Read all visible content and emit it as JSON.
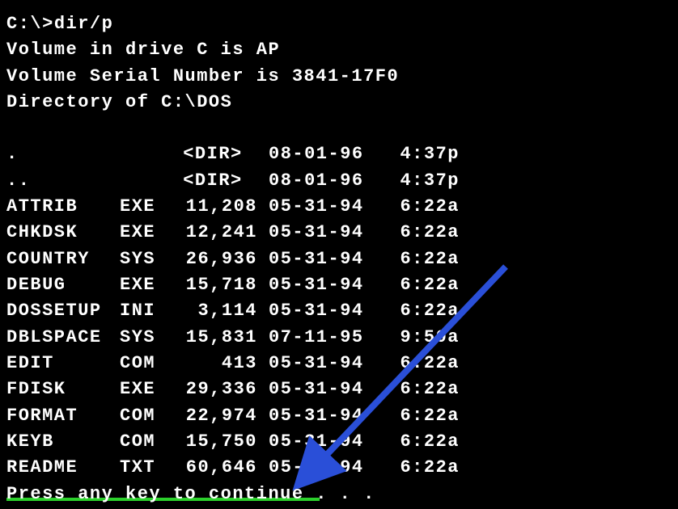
{
  "command": {
    "prompt": "C:\\>",
    "text": "dir/p"
  },
  "header": {
    "volume_line": " Volume in drive C is AP",
    "serial_line": " Volume Serial Number is 3841-17F0",
    "directory_line": " Directory of C:\\DOS"
  },
  "entries": [
    {
      "name": ".",
      "ext": "",
      "size": "",
      "dir": true,
      "date": "08-01-96",
      "time": "4:37p"
    },
    {
      "name": "..",
      "ext": "",
      "size": "",
      "dir": true,
      "date": "08-01-96",
      "time": "4:37p"
    },
    {
      "name": "ATTRIB",
      "ext": "EXE",
      "size": "11,208",
      "dir": false,
      "date": "05-31-94",
      "time": "6:22a"
    },
    {
      "name": "CHKDSK",
      "ext": "EXE",
      "size": "12,241",
      "dir": false,
      "date": "05-31-94",
      "time": "6:22a"
    },
    {
      "name": "COUNTRY",
      "ext": "SYS",
      "size": "26,936",
      "dir": false,
      "date": "05-31-94",
      "time": "6:22a"
    },
    {
      "name": "DEBUG",
      "ext": "EXE",
      "size": "15,718",
      "dir": false,
      "date": "05-31-94",
      "time": "6:22a"
    },
    {
      "name": "DOSSETUP",
      "ext": "INI",
      "size": "3,114",
      "dir": false,
      "date": "05-31-94",
      "time": "6:22a"
    },
    {
      "name": "DBLSPACE",
      "ext": "SYS",
      "size": "15,831",
      "dir": false,
      "date": "07-11-95",
      "time": "9:50a"
    },
    {
      "name": "EDIT",
      "ext": "COM",
      "size": "413",
      "dir": false,
      "date": "05-31-94",
      "time": "6:22a"
    },
    {
      "name": "FDISK",
      "ext": "EXE",
      "size": "29,336",
      "dir": false,
      "date": "05-31-94",
      "time": "6:22a"
    },
    {
      "name": "FORMAT",
      "ext": "COM",
      "size": "22,974",
      "dir": false,
      "date": "05-31-94",
      "time": "6:22a"
    },
    {
      "name": "KEYB",
      "ext": "COM",
      "size": "15,750",
      "dir": false,
      "date": "05-31-94",
      "time": "6:22a"
    },
    {
      "name": "README",
      "ext": "TXT",
      "size": "60,646",
      "dir": false,
      "date": "05-31-94",
      "time": "6:22a"
    }
  ],
  "dir_tag": "<DIR>",
  "continue_prompt": "Press any key to continue . . .",
  "arrow_color": "#2a4fd8",
  "underline_color": "#2cd02c"
}
